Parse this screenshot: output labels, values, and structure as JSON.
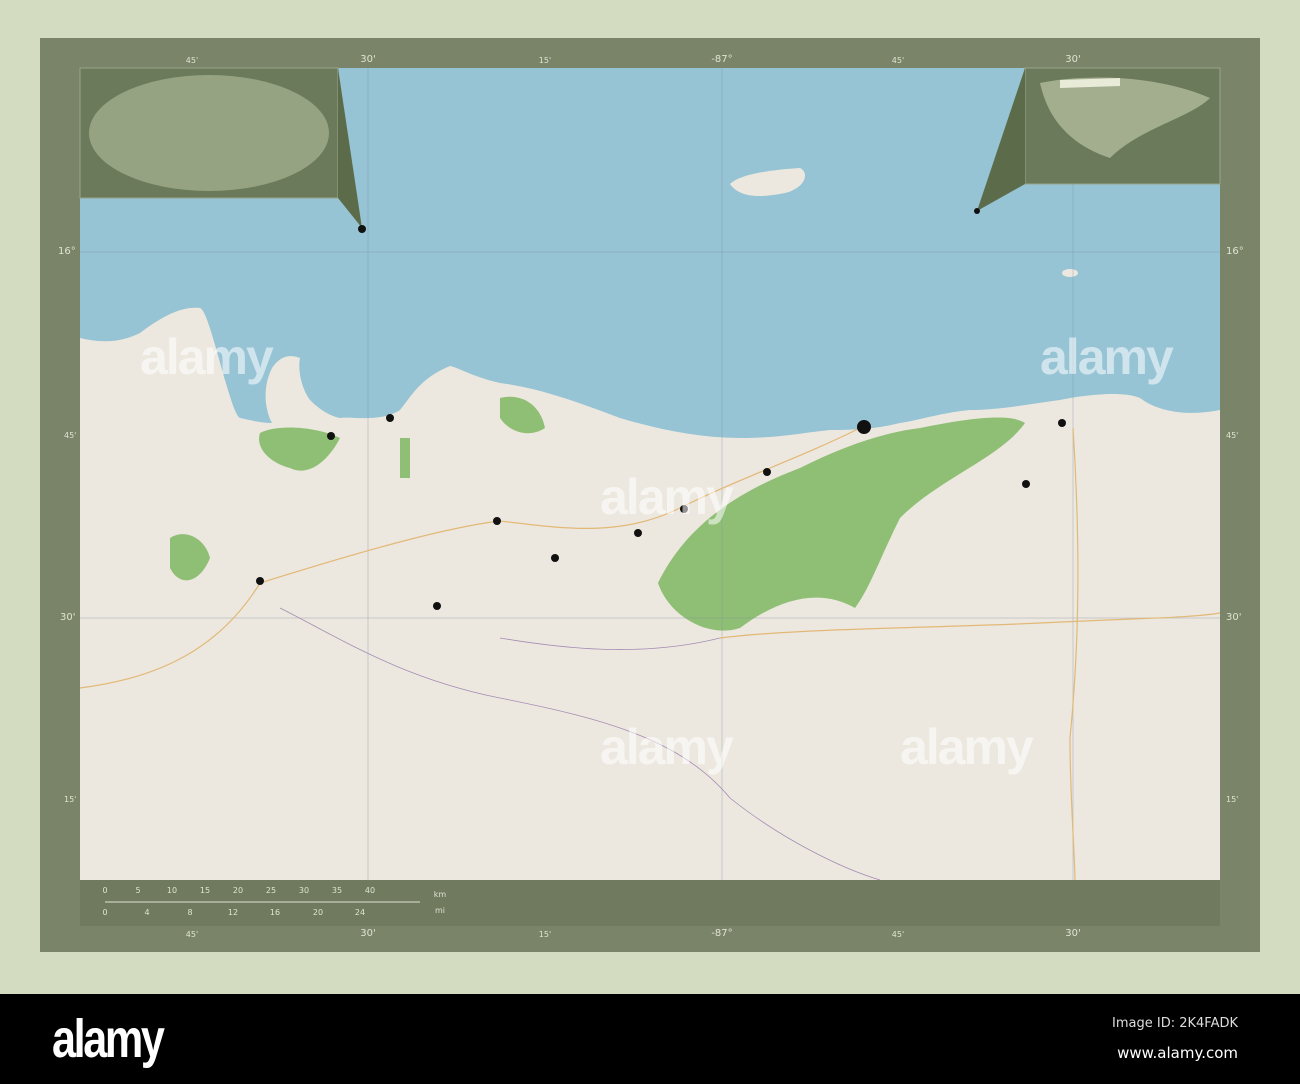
{
  "map": {
    "top_ticks": [
      "45'",
      "30'",
      "15'",
      "-87°",
      "45'",
      "30'"
    ],
    "bottom_ticks": [
      "45'",
      "30'",
      "15'",
      "-87°",
      "45'",
      "30'"
    ],
    "left_ticks": [
      "16°",
      "45'",
      "30'",
      "15'"
    ],
    "right_ticks": [
      "16°",
      "45'",
      "30'",
      "15'"
    ],
    "scale": {
      "km_label": "km",
      "mi_label": "mi",
      "km": [
        "0",
        "5",
        "10",
        "15",
        "20",
        "25",
        "30",
        "35",
        "40"
      ],
      "mi": [
        "0",
        "4",
        "8",
        "12",
        "16",
        "20",
        "24"
      ]
    },
    "colors": {
      "sea": "#96c4d4",
      "land": "#ede8df",
      "park": "#8fbf74",
      "frame": "#7a8468"
    }
  },
  "watermark": {
    "text": "alamy"
  },
  "banner": {
    "logo": "alamy",
    "image_id": "Image ID: 2K4FADK",
    "site": "www.alamy.com"
  }
}
